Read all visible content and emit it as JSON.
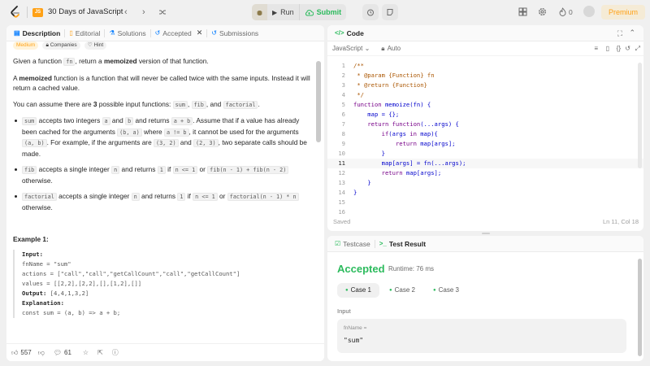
{
  "topbar": {
    "title": "30 Days of JavaScript",
    "js_badge": "JS",
    "run_label": "Run",
    "submit_label": "Submit",
    "streak_count": "0",
    "premium_label": "Premium"
  },
  "left_tabs": [
    {
      "label": "Description",
      "icon": "description-icon"
    },
    {
      "label": "Editorial",
      "icon": "editorial-icon"
    },
    {
      "label": "Solutions",
      "icon": "solutions-icon"
    },
    {
      "label": "Accepted",
      "icon": "history-icon"
    },
    {
      "label": "Submissions",
      "icon": "submissions-icon"
    }
  ],
  "tags": {
    "difficulty": "Medium",
    "companies": "Companies",
    "hint": "Hint"
  },
  "description": {
    "p1_a": "Given a function ",
    "p1_code": "fn",
    "p1_b": ", return a ",
    "p1_bold": "memoized",
    "p1_c": " version of that function.",
    "p2_a": "A ",
    "p2_bold": "memoized",
    "p2_b": " function is a function that will never be called twice with the same inputs. Instead it will return a cached value.",
    "p3_a": "You can assume there are ",
    "p3_bold": "3",
    "p3_b": " possible input functions: ",
    "p3_c1": "sum",
    "p3_sep1": ", ",
    "p3_c2": "fib",
    "p3_sep2": ", and ",
    "p3_c3": "factorial",
    "p3_end": ".",
    "b1": {
      "c1": "sum",
      "t1": " accepts two integers ",
      "c2": "a",
      "t2": " and ",
      "c3": "b",
      "t3": " and returns ",
      "c4": "a + b",
      "t4": ". Assume that if a value has already been cached for the arguments ",
      "c5": "(b, a)",
      "t5": " where ",
      "c6": "a != b",
      "t6": ", it cannot be used for the arguments ",
      "c7": "(a, b)",
      "t7": ". For example, if the arguments are ",
      "c8": "(3, 2)",
      "t8": " and ",
      "c9": "(2, 3)",
      "t9": ", two separate calls should be made."
    },
    "b2": {
      "c1": "fib",
      "t1": " accepts a single integer ",
      "c2": "n",
      "t2": " and returns ",
      "c3": "1",
      "t3": " if ",
      "c4": "n <= 1",
      "t4": " or ",
      "c5": "fib(n - 1) + fib(n - 2)",
      "t5": " otherwise."
    },
    "b3": {
      "c1": "factorial",
      "t1": " accepts a single integer ",
      "c2": "n",
      "t2": " and returns ",
      "c3": "1",
      "t3": " if ",
      "c4": "n <= 1",
      "t4": " or ",
      "c5": "factorial(n - 1) * n",
      "t5": " otherwise."
    },
    "example_title": "Example 1:",
    "ex_input_label": "Input:",
    "ex_line1": "fnName = \"sum\"",
    "ex_line2": "actions = [\"call\",\"call\",\"getCallCount\",\"call\",\"getCallCount\"]",
    "ex_line3": "values = [[2,2],[2,2],[],[1,2],[]]",
    "ex_output_label": "Output:",
    "ex_output": " [4,4,1,3,2]",
    "ex_expl_label": "Explanation:",
    "ex_line4": "const sum = (a, b) => a + b;"
  },
  "footer": {
    "likes": "557",
    "comments": "61"
  },
  "code_panel": {
    "title": "Code",
    "language": "JavaScript",
    "mode": "Auto",
    "lines": [
      "/**",
      " * @param {Function} fn",
      " * @return {Function}",
      " */",
      "function memoize(fn) {",
      "    map = {};",
      "    return function(...args) {",
      "        if(args in map){",
      "            return map[args];",
      "        }",
      "        map[args] = fn(...args);",
      "        return map[args];",
      "    }",
      "}",
      "",
      ""
    ],
    "current_line": 11,
    "status": "Saved",
    "cursor": "Ln 11, Col 18"
  },
  "test_panel": {
    "tab_testcase": "Testcase",
    "tab_result": "Test Result",
    "verdict": "Accepted",
    "runtime": "Runtime: 76 ms",
    "cases": [
      "Case 1",
      "Case 2",
      "Case 3"
    ],
    "input_label": "Input",
    "param_name": "fnName =",
    "param_value": "\"sum\""
  },
  "colors": {
    "accent": "#ffa116",
    "success": "#2cbb5d"
  }
}
